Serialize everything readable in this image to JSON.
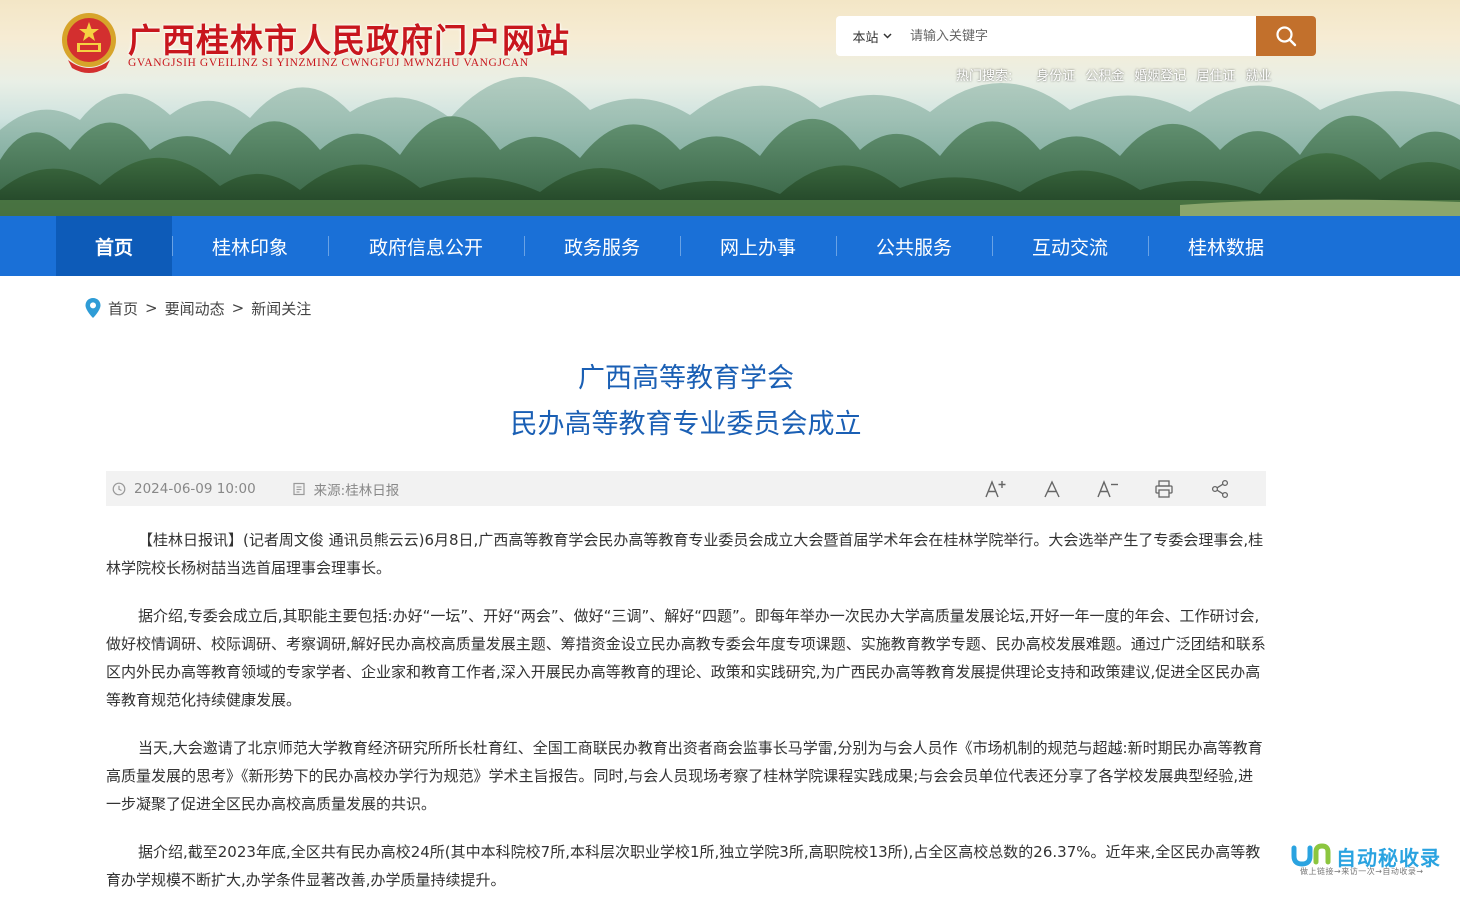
{
  "site": {
    "title": "广西桂林市人民政府门户网站",
    "subtitle": "GVANGJSIH GVEILINZ SI YINZMINZ CWNGFUJ MWNZHU VANGJCAN"
  },
  "search": {
    "scope": "本站",
    "placeholder": "请输入关键字"
  },
  "hot_search": {
    "label": "热门搜索:",
    "items": [
      "身份证",
      "公积金",
      "婚姻登记",
      "居住证",
      "就业"
    ]
  },
  "nav": {
    "items": [
      "首页",
      "桂林印象",
      "政府信息公开",
      "政务服务",
      "网上办事",
      "公共服务",
      "互动交流",
      "桂林数据"
    ],
    "active": "首页"
  },
  "breadcrumb": {
    "items": [
      "首页",
      "要闻动态",
      "新闻关注"
    ],
    "separator": ">"
  },
  "article": {
    "title_line1": "广西高等教育学会",
    "title_line2": "民办高等教育专业委员会成立",
    "date": "2024-06-09 10:00",
    "source": "来源:桂林日报",
    "tools": [
      "font-increase-icon",
      "font-normal-icon",
      "font-decrease-icon",
      "print-icon",
      "share-icon"
    ],
    "paragraphs": [
      "【桂林日报讯】(记者周文俊 通讯员熊云云)6月8日,广西高等教育学会民办高等教育专业委员会成立大会暨首届学术年会在桂林学院举行。大会选举产生了专委会理事会,桂林学院校长杨树喆当选首届理事会理事长。",
      "据介绍,专委会成立后,其职能主要包括:办好“一坛”、开好“两会”、做好“三调”、解好“四题”。即每年举办一次民办大学高质量发展论坛,开好一年一度的年会、工作研讨会,做好校情调研、校际调研、考察调研,解好民办高校高质量发展主题、筹措资金设立民办高教专委会年度专项课题、实施教育教学专题、民办高校发展难题。通过广泛团结和联系区内外民办高等教育领域的专家学者、企业家和教育工作者,深入开展民办高等教育的理论、政策和实践研究,为广西民办高等教育发展提供理论支持和政策建议,促进全区民办高等教育规范化持续健康发展。",
      "当天,大会邀请了北京师范大学教育经济研究所所长杜育红、全国工商联民办教育出资者商会监事长马学雷,分别为与会人员作《市场机制的规范与超越:新时期民办高等教育高质量发展的思考》《新形势下的民办高校办学行为规范》学术主旨报告。同时,与会人员现场考察了桂林学院课程实践成果;与会会员单位代表还分享了各学校发展典型经验,进一步凝聚了促进全区民办高校高质量发展的共识。",
      "据介绍,截至2023年底,全区共有民办高校24所(其中本科院校7所,本科层次职业学校1所,独立学院3所,高职院校13所),占全区高校总数的26.37%。近年来,全区民办高等教育办学规模不断扩大,办学条件显著改善,办学质量持续提升。"
    ]
  },
  "watermark": {
    "main": "自动秘收录",
    "sub": "做上链接→来访一次→自动收录→"
  },
  "colors": {
    "nav_bg": "#1a70d7",
    "nav_active": "#0d5bb8",
    "title_blue": "#1a5fb4",
    "brand_red": "#c8161d",
    "search_button": "#c2702c"
  }
}
